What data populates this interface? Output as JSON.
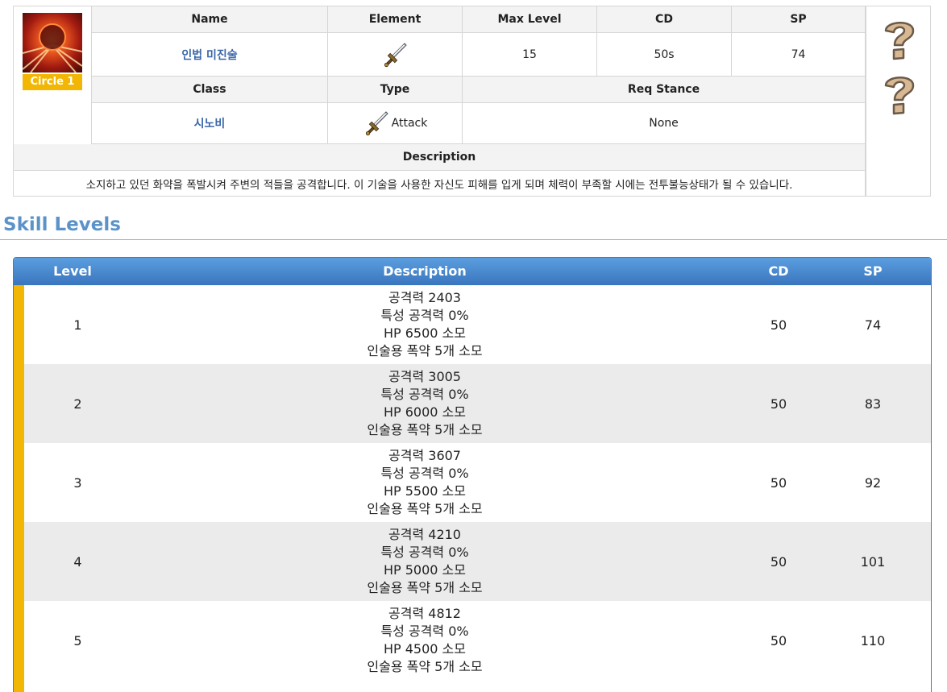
{
  "skill": {
    "circle_badge": "Circle 1",
    "headers": {
      "name": "Name",
      "element": "Element",
      "max_level": "Max Level",
      "cd": "CD",
      "sp": "SP",
      "class": "Class",
      "type": "Type",
      "req_stance": "Req Stance",
      "description": "Description"
    },
    "name": "인법 미진술",
    "element_icon": "sword-icon",
    "max_level": "15",
    "cd": "50s",
    "sp": "74",
    "class": "시노비",
    "type": "Attack",
    "type_icon": "sword-icon",
    "req_stance": "None",
    "description": "소지하고 있던 화약을 폭발시켜 주변의 적들을 공격합니다. 이 기술을 사용한 자신도 피해를 입게 되며 체력이 부족할 시에는 전투불능상태가 될 수 있습니다.",
    "side_icons": [
      "question-mark-icon",
      "question-mark-icon"
    ]
  },
  "section_title": "Skill Levels",
  "levels_table": {
    "headers": {
      "level": "Level",
      "description": "Description",
      "cd": "CD",
      "sp": "SP"
    },
    "rows": [
      {
        "level": "1",
        "lines": [
          "공격력 2403",
          "특성 공격력 0%",
          "HP 6500 소모",
          "인술용 폭약 5개 소모"
        ],
        "cd": "50",
        "sp": "74"
      },
      {
        "level": "2",
        "lines": [
          "공격력 3005",
          "특성 공격력 0%",
          "HP 6000 소모",
          "인술용 폭약 5개 소모"
        ],
        "cd": "50",
        "sp": "83"
      },
      {
        "level": "3",
        "lines": [
          "공격력 3607",
          "특성 공격력 0%",
          "HP 5500 소모",
          "인술용 폭약 5개 소모"
        ],
        "cd": "50",
        "sp": "92"
      },
      {
        "level": "4",
        "lines": [
          "공격력 4210",
          "특성 공격력 0%",
          "HP 5000 소모",
          "인술용 폭약 5개 소모"
        ],
        "cd": "50",
        "sp": "101"
      },
      {
        "level": "5",
        "lines": [
          "공격력 4812",
          "특성 공격력 0%",
          "HP 4500 소모",
          "인술용 폭약 5개 소모"
        ],
        "cd": "50",
        "sp": "110"
      }
    ]
  },
  "colors": {
    "accent": "#f2b705",
    "header_blue": "#3a75bd",
    "link": "#3a66a8",
    "title": "#5b93c9"
  }
}
